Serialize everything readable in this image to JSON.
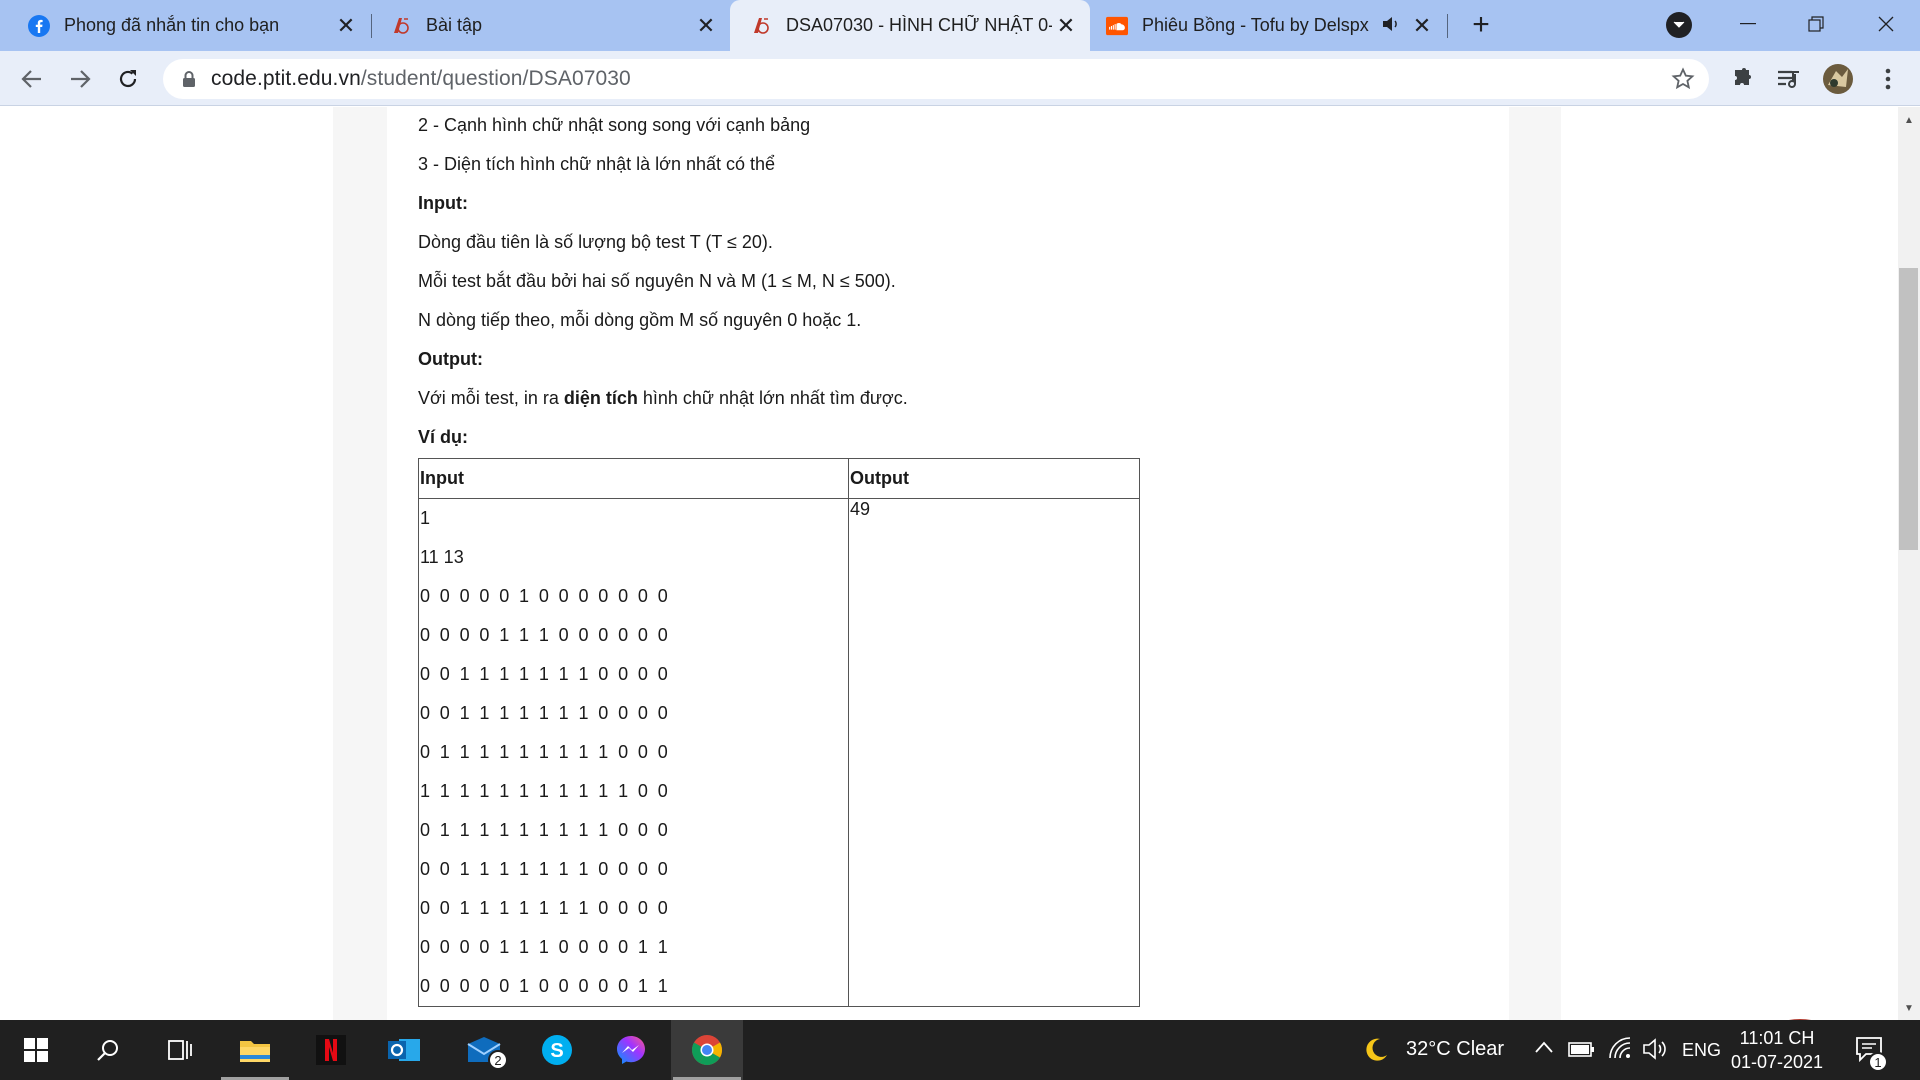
{
  "browser": {
    "tabs": [
      {
        "title": "Phong đã nhắn tin cho bạn",
        "icon": "facebook-icon"
      },
      {
        "title": "Bài tập",
        "icon": "ptit-icon"
      },
      {
        "title": "DSA07030 - HÌNH CHỮ NHẬT 0-",
        "icon": "ptit-icon"
      },
      {
        "title": "Phiêu Bồng - Tofu by Delspx",
        "icon": "soundcloud-icon"
      }
    ],
    "url_host": "code.ptit.edu.vn",
    "url_path": "/student/question/DSA07030"
  },
  "problem": {
    "rule2": "2 - Cạnh hình chữ nhật song song với cạnh bảng",
    "rule3": "3 - Diện tích hình chữ nhật là lớn nhất có thể",
    "input_heading": "Input:",
    "input_line1": "Dòng đầu tiên là số lượng bộ test T (T ≤ 20).",
    "input_line2": "Mỗi test bắt đầu bởi hai số nguyên N và M (1 ≤ M, N ≤ 500).",
    "input_line3": "N dòng tiếp theo, mỗi dòng gồm M số nguyên 0 hoặc 1.",
    "output_heading": "Output:",
    "output_prefix": "Với mỗi test, in ra ",
    "output_bold": "diện tích",
    "output_suffix": " hình chữ nhật lớn nhất tìm được.",
    "example_heading": "Ví dụ:",
    "table": {
      "col_input": "Input",
      "col_output": "Output",
      "input_lines": [
        "1",
        "11 13",
        "0 0 0 0 0 1 0 0 0 0 0 0 0",
        "0 0 0 0 1 1 1 0 0 0 0 0 0",
        "0 0 1 1 1 1 1 1 1 0 0 0 0",
        "0 0 1 1 1 1 1 1 1 0 0 0 0",
        "0 1 1 1 1 1 1 1 1 1 0 0 0",
        "1 1 1 1 1 1 1 1 1 1 1 0 0",
        "0 1 1 1 1 1 1 1 1 1 0 0 0",
        "0 0 1 1 1 1 1 1 1 0 0 0 0",
        "0 0 1 1 1 1 1 1 1 0 0 0 0",
        "0 0 0 0 1 1 1 0 0 0 0 1 1",
        "0 0 0 0 0 1 0 0 0 0 0 1 1"
      ],
      "output_value": "49"
    }
  },
  "chat_widget": {
    "count": "1"
  },
  "taskbar": {
    "mail_badge": "2",
    "weather": "32°C  Clear",
    "language": "ENG",
    "time": "11:01 CH",
    "date": "01-07-2021",
    "notification_badge": "1"
  },
  "colors": {
    "tab_strip": "#a7c3f2",
    "toolbar": "#e8eef9",
    "taskbar": "#202020",
    "chat_bubble": "#c0392b"
  }
}
